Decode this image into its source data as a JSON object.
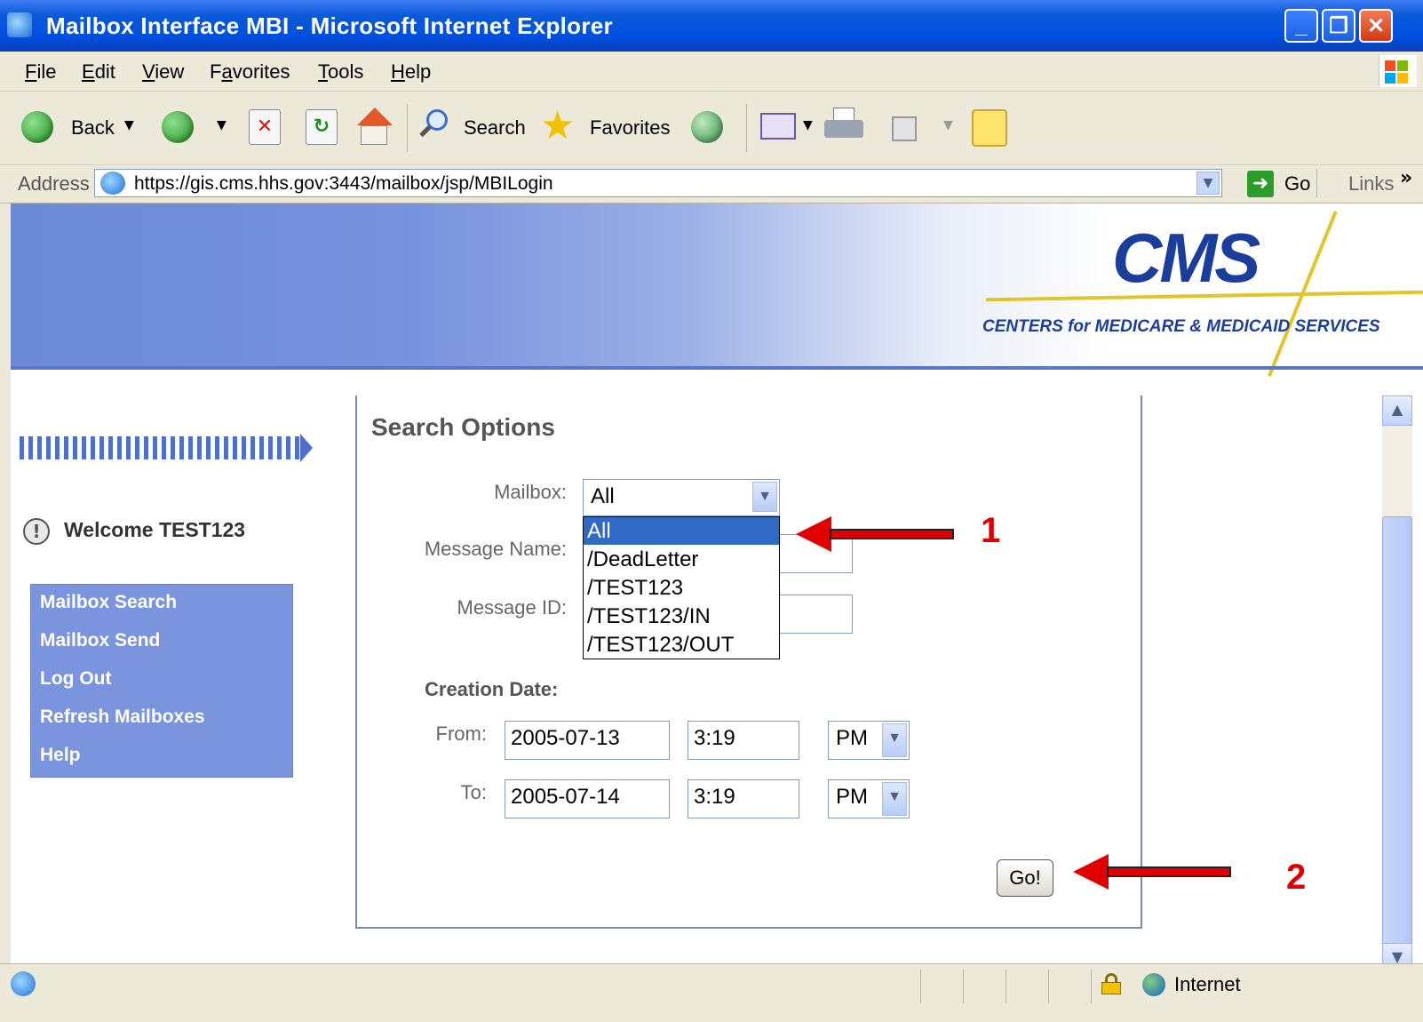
{
  "window": {
    "title": "Mailbox Interface MBI - Microsoft Internet Explorer",
    "minimize": "_",
    "maximize": "❐",
    "close": "✕"
  },
  "menu": [
    "File",
    "Edit",
    "View",
    "Favorites",
    "Tools",
    "Help"
  ],
  "toolbar": {
    "back_label": "Back",
    "search_label": "Search",
    "favorites_label": "Favorites"
  },
  "address": {
    "label": "Address",
    "url": "https://gis.cms.hhs.gov:3443/mailbox/jsp/MBILogin",
    "go_label": "Go",
    "links_label": "Links",
    "chevron": "»"
  },
  "banner": {
    "logo": "CMS",
    "subtitle": "CENTERS for MEDICARE & MEDICAID SERVICES"
  },
  "sidebar": {
    "welcome": "Welcome TEST123",
    "links": [
      "Mailbox Search",
      "Mailbox Send",
      "Log Out",
      "Refresh Mailboxes",
      "Help"
    ]
  },
  "form": {
    "title": "Search Options",
    "mailbox_label": "Mailbox:",
    "mailbox_value": "All",
    "message_name_label": "Message Name:",
    "message_id_label": "Message ID:",
    "creation_date_label": "Creation Date:",
    "from_label": "From:",
    "from_date": "2005-07-13",
    "from_time": "3:19",
    "from_ampm": "PM",
    "to_label": "To:",
    "to_date": "2005-07-14",
    "to_time": "3:19",
    "to_ampm": "PM",
    "go_button": "Go!",
    "dropdown_options": [
      "All",
      "/DeadLetter",
      "/TEST123",
      "/TEST123/IN",
      "/TEST123/OUT"
    ]
  },
  "annotations": [
    "1",
    "2"
  ],
  "status": {
    "zone": "Internet"
  },
  "colors": {
    "titlebar": "#0050e0",
    "banner": "#7792dd",
    "nav_panel": "#7a94dd",
    "dropdown_selected": "#316ac5",
    "annotation": "#e00000",
    "cms_blue": "#1b3d9c"
  }
}
